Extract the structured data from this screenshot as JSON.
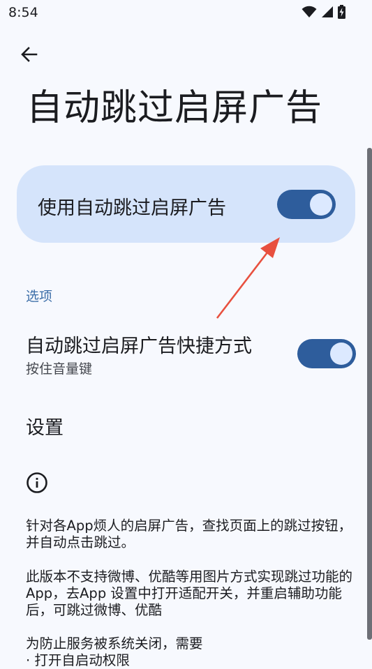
{
  "status_bar": {
    "time": "8:54"
  },
  "page": {
    "title": "自动跳过启屏广告"
  },
  "main_switch": {
    "label": "使用自动跳过启屏广告",
    "checked": true
  },
  "options_section": {
    "header": "选项",
    "shortcut": {
      "title": "自动跳过启屏广告快捷方式",
      "summary": "按住音量键",
      "checked": true
    }
  },
  "settings": {
    "label": "设置"
  },
  "info": {
    "p1": "针对各App烦人的启屏广告，查找页面上的跳过按钮，并自动点击跳过。",
    "p2": "此版本不支持微博、优酷等用图片方式实现跳过功能的App，去App 设置中打开适配开关，并重启辅助功能后，可跳过微博、优酷",
    "p3": "为防止服务被系统关闭，需要",
    "p4": "· 打开自启动权限"
  },
  "colors": {
    "background": "#f7f9fe",
    "card": "#d5e4fb",
    "toggle_track": "#2e5d9c",
    "toggle_thumb": "#dce9ff",
    "accent_text": "#3c6ea8",
    "annotation": "#e8503f"
  },
  "icons": {
    "back": "arrow-left-icon",
    "wifi": "wifi-icon",
    "signal": "signal-icon",
    "battery": "battery-charging-icon",
    "info": "info-circle-icon"
  }
}
